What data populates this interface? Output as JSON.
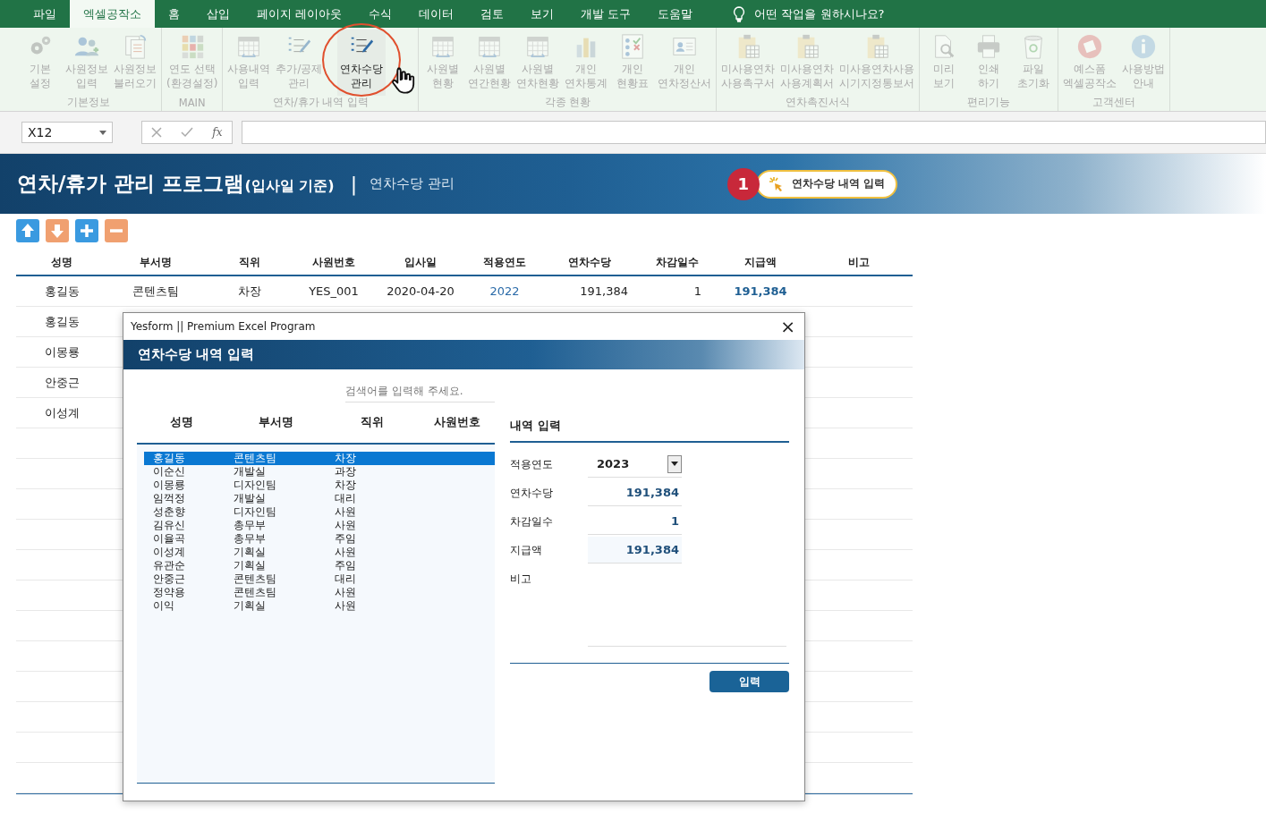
{
  "menu_tabs": [
    {
      "label": "파일",
      "selected": false
    },
    {
      "label": "엑셀공작소",
      "selected": true
    },
    {
      "label": "홈",
      "selected": false
    },
    {
      "label": "삽입",
      "selected": false
    },
    {
      "label": "페이지 레이아웃",
      "selected": false
    },
    {
      "label": "수식",
      "selected": false
    },
    {
      "label": "데이터",
      "selected": false
    },
    {
      "label": "검토",
      "selected": false
    },
    {
      "label": "보기",
      "selected": false
    },
    {
      "label": "개발 도구",
      "selected": false
    },
    {
      "label": "도움말",
      "selected": false
    }
  ],
  "tell_me": "어떤 작업을 원하시나요?",
  "ribbon": {
    "groups": [
      {
        "label": "기본정보",
        "items": [
          {
            "label": "기본\n설정",
            "active": false
          },
          {
            "label": "사원정보\n입력",
            "active": false
          },
          {
            "label": "사원정보\n불러오기",
            "active": false
          }
        ]
      },
      {
        "label": "MAIN",
        "items": [
          {
            "label": "연도 선택\n(환경설정)",
            "active": false
          }
        ]
      },
      {
        "label": "연차/휴가 내역 입력",
        "items": [
          {
            "label": "사용내역\n입력",
            "active": false
          },
          {
            "label": "추가/공제\n관리",
            "active": false
          },
          {
            "label": "연차수당\n관리",
            "active": true
          }
        ]
      },
      {
        "label": "각종 현황",
        "items": [
          {
            "label": "사원별\n현황",
            "active": false
          },
          {
            "label": "사원별\n연간현황",
            "active": false
          },
          {
            "label": "사원별\n연차현황",
            "active": false
          },
          {
            "label": "개인\n연차통계",
            "active": false
          },
          {
            "label": "개인\n현황표",
            "active": false
          },
          {
            "label": "개인\n연차정산서",
            "active": false
          }
        ]
      },
      {
        "label": "연차촉진서식",
        "items": [
          {
            "label": "미사용연차\n사용촉구서",
            "active": false
          },
          {
            "label": "미사용연차\n사용계획서",
            "active": false
          },
          {
            "label": "미사용연차사용\n시기지정통보서",
            "active": false
          }
        ]
      },
      {
        "label": "편리기능",
        "items": [
          {
            "label": "미리\n보기",
            "active": false
          },
          {
            "label": "인쇄\n하기",
            "active": false
          },
          {
            "label": "파일\n초기화",
            "active": false
          }
        ]
      },
      {
        "label": "고객센터",
        "items": [
          {
            "label": "예스폼\n엑셀공작소",
            "active": false
          },
          {
            "label": "사용방법\n안내",
            "active": false
          }
        ]
      }
    ]
  },
  "formula_bar": {
    "name_box": "X12",
    "fx_label": "fx"
  },
  "banner": {
    "title": "연차/휴가 관리 프로그램",
    "title_note": "(입사일 기준)",
    "separator": "|",
    "subtitle": "연차수당 관리",
    "step_badge": "1",
    "action_button": "연차수당 내역 입력"
  },
  "sheet": {
    "columns": [
      "성명",
      "부서명",
      "직위",
      "사원번호",
      "입사일",
      "적용연도",
      "연차수당",
      "차감일수",
      "지급액",
      "비고"
    ],
    "rows": [
      [
        "홍길동",
        "콘텐츠팀",
        "차장",
        "YES_001",
        "2020-04-20",
        "2022",
        "191,384",
        "1",
        "191,384",
        ""
      ],
      [
        "홍길동"
      ],
      [
        "이몽룡"
      ],
      [
        "안중근"
      ],
      [
        "이성계"
      ]
    ]
  },
  "dialog": {
    "title": "Yesform  ||  Premium Excel Program",
    "close": "×",
    "header": "연차수당 내역 입력",
    "search": {
      "placeholder": "검색어를 입력해 주세요."
    },
    "list_columns": [
      "성명",
      "부서명",
      "직위",
      "사원번호"
    ],
    "list_rows": [
      {
        "cells": [
          "홍길동",
          "콘텐츠팀",
          "차장"
        ],
        "selected": true
      },
      {
        "cells": [
          "이순신",
          "개발실",
          "과장"
        ],
        "selected": false
      },
      {
        "cells": [
          "이몽룡",
          "디자인팀",
          "차장"
        ],
        "selected": false
      },
      {
        "cells": [
          "임꺽정",
          "개발실",
          "대리"
        ],
        "selected": false
      },
      {
        "cells": [
          "성춘향",
          "디자인팀",
          "사원"
        ],
        "selected": false
      },
      {
        "cells": [
          "김유신",
          "총무부",
          "사원"
        ],
        "selected": false
      },
      {
        "cells": [
          "이율곡",
          "총무부",
          "주임"
        ],
        "selected": false
      },
      {
        "cells": [
          "이성계",
          "기획실",
          "사원"
        ],
        "selected": false
      },
      {
        "cells": [
          "유관순",
          "기획실",
          "주임"
        ],
        "selected": false
      },
      {
        "cells": [
          "안중근",
          "콘텐츠팀",
          "대리"
        ],
        "selected": false
      },
      {
        "cells": [
          "정약용",
          "콘텐츠팀",
          "사원"
        ],
        "selected": false
      },
      {
        "cells": [
          "이익",
          "기획실",
          "사원"
        ],
        "selected": false
      }
    ],
    "form_title": "내역 입력",
    "fields": [
      {
        "label": "적용연도",
        "value": "2023",
        "kind": "dropdown"
      },
      {
        "label": "연차수당",
        "value": "191,384",
        "kind": "number"
      },
      {
        "label": "차감일수",
        "value": "1",
        "kind": "number"
      },
      {
        "label": "지급액",
        "value": "191,384",
        "kind": "total"
      },
      {
        "label": "비고",
        "kind": "memo"
      }
    ],
    "submit": "입력"
  }
}
